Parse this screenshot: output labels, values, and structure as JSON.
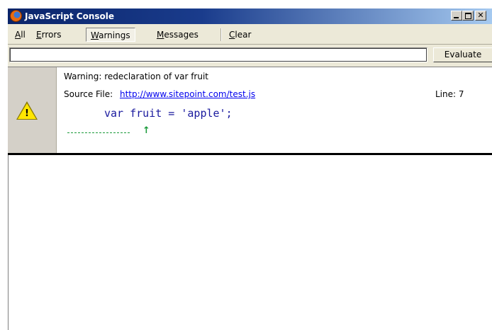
{
  "window": {
    "title": "JavaScript Console",
    "icon": "firefox-icon",
    "controls": {
      "minimize": "minimize-icon",
      "maximize": "maximize-icon",
      "close": "✕"
    }
  },
  "toolbar": {
    "all": {
      "u": "A",
      "rest": "ll"
    },
    "errors": {
      "u": "E",
      "rest": "rrors"
    },
    "warnings": {
      "u": "W",
      "rest": "arnings"
    },
    "messages": {
      "u": "M",
      "rest": "essages"
    },
    "clear": {
      "u": "C",
      "rest": "lear"
    },
    "active": "warnings"
  },
  "evaluate": {
    "input_value": "",
    "button_label": "Evaluate"
  },
  "messages": [
    {
      "type": "warning",
      "icon": "warning-icon",
      "text": "Warning:   redeclaration of var fruit",
      "source_label": "Source File:",
      "source_url": "http://www.sitepoint.com/test.js",
      "line_label": "Line:   7",
      "code": "var fruit = 'apple';",
      "caret": "↑"
    }
  ],
  "colors": {
    "titlebar_start": "#0a246a",
    "titlebar_end": "#a6caf0",
    "chrome": "#ece9d8",
    "link": "#0000ee",
    "code": "#1a1a9e",
    "caret": "#1a9a3a",
    "warning_yellow": "#ffe600"
  }
}
